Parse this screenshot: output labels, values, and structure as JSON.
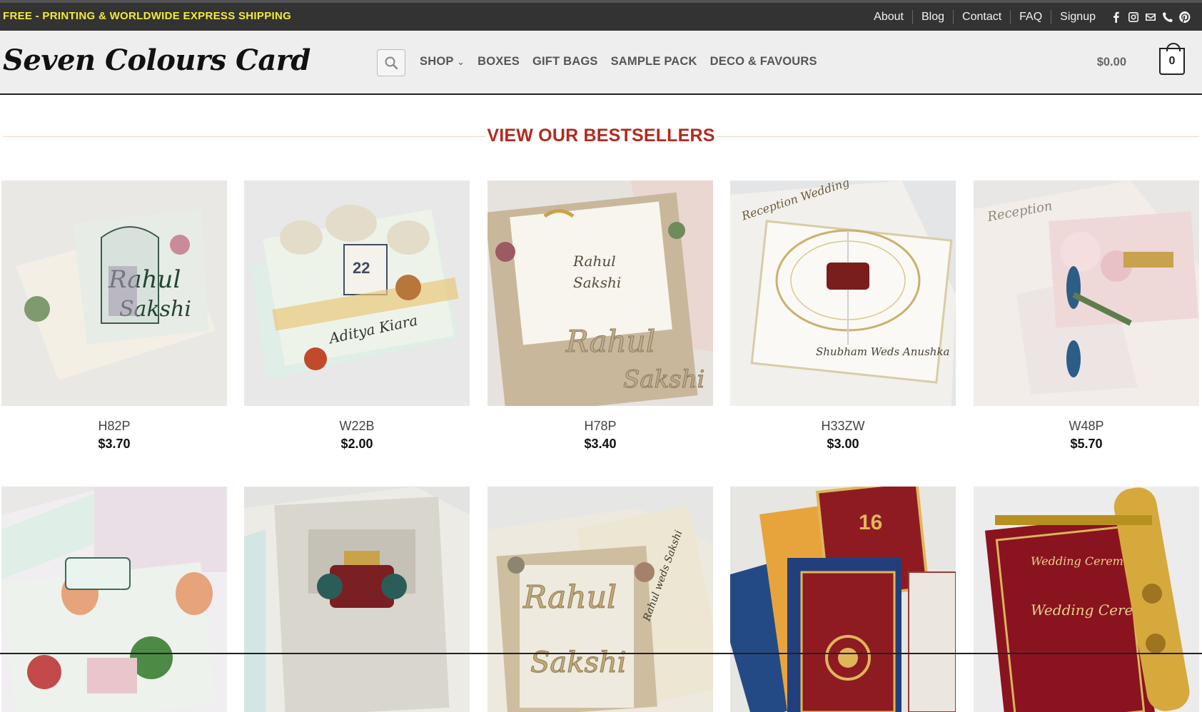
{
  "topbar": {
    "promo": "FREE - PRINTING & WORLDWIDE EXPRESS SHIPPING",
    "links": [
      "About",
      "Blog",
      "Contact",
      "FAQ",
      "Signup"
    ],
    "social_icons": [
      "facebook-icon",
      "instagram-icon",
      "email-icon",
      "phone-icon",
      "pinterest-icon"
    ]
  },
  "header": {
    "logo": "Seven Colours Card",
    "nav": [
      "SHOP",
      "BOXES",
      "GIFT BAGS",
      "SAMPLE PACK",
      "DECO & FAVOURS"
    ],
    "cart_total": "$0.00",
    "cart_count": "0"
  },
  "section": {
    "title": "VIEW OUR BESTSELLERS"
  },
  "products": [
    {
      "name": "H82P",
      "price": "$3.70"
    },
    {
      "name": "W22B",
      "price": "$2.00"
    },
    {
      "name": "H78P",
      "price": "$3.40"
    },
    {
      "name": "H33ZW",
      "price": "$3.00"
    },
    {
      "name": "W48P",
      "price": "$5.70"
    }
  ],
  "colors": {
    "topbar_bg": "#333333",
    "promo": "#f5e93b",
    "header_bg": "#eeeeee",
    "accent_title": "#b22a1e"
  }
}
